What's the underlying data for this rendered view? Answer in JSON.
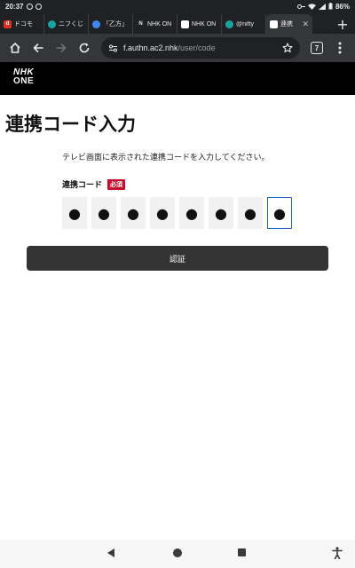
{
  "status_bar": {
    "time": "20:37",
    "battery": "86%"
  },
  "tabs": [
    {
      "title": "ドコモ",
      "favicon": "d",
      "favicon_color": "#e0301e",
      "active": false
    },
    {
      "title": "ニフくじ",
      "favicon": "",
      "favicon_color": "#1aa3a3",
      "active": false
    },
    {
      "title": "「乙方」",
      "favicon": "",
      "favicon_color": "#4285f4",
      "active": false
    },
    {
      "title": "NHK ON",
      "favicon": "N",
      "favicon_color": "#202124",
      "active": false
    },
    {
      "title": "NHK ON",
      "favicon": "",
      "favicon_color": "#ffffff",
      "active": false
    },
    {
      "title": "@nifty",
      "favicon": "",
      "favicon_color": "#1aa3a3",
      "active": false
    },
    {
      "title": "連携",
      "favicon": "",
      "favicon_color": "#ffffff",
      "active": true
    }
  ],
  "toolbar": {
    "url_host": "f.authn.ac2.nhk",
    "url_path": "/user/code",
    "tab_count": "7"
  },
  "site": {
    "logo_line1": "NHK",
    "logo_line2": "ONE"
  },
  "main": {
    "title": "連携コード入力",
    "instruction": "テレビ画面に表示された連携コードを入力してください。",
    "field_label": "連携コード",
    "required_badge": "必須",
    "code_digits": [
      "●",
      "●",
      "●",
      "●",
      "●",
      "●",
      "●",
      "●"
    ],
    "focused_index": 7,
    "submit_label": "認証"
  },
  "colors": {
    "accent": "#1565c0",
    "required": "#c8102e",
    "button": "#333333",
    "header": "#000000"
  }
}
